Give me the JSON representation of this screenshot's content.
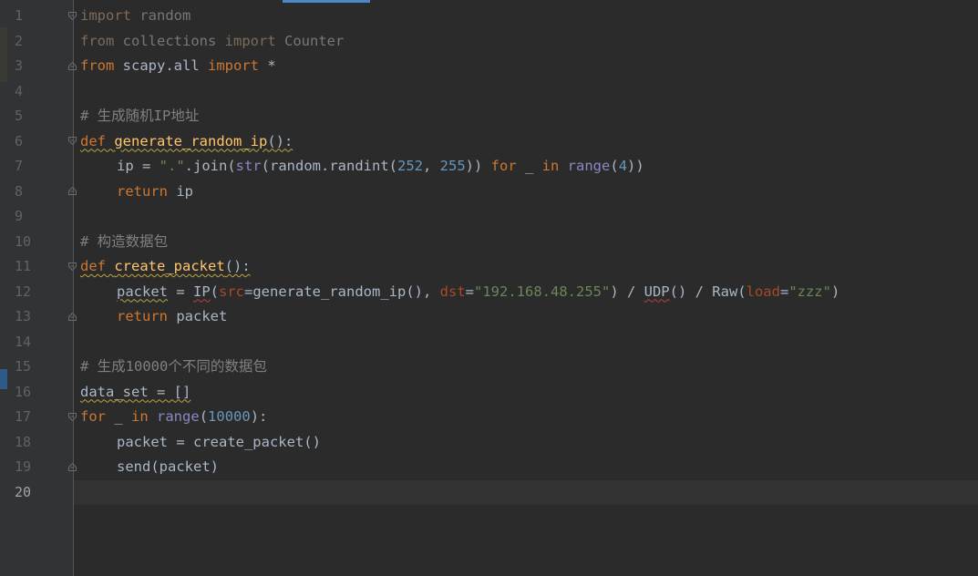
{
  "line_numbers": [
    "1",
    "2",
    "3",
    "4",
    "5",
    "6",
    "7",
    "8",
    "9",
    "10",
    "11",
    "12",
    "13",
    "14",
    "15",
    "16",
    "17",
    "18",
    "19",
    "20"
  ],
  "code": {
    "l1": {
      "kw": "import",
      "rest": " random"
    },
    "l2": {
      "kw1": "from",
      "mod": " collections ",
      "kw2": "import",
      "rest": " Counter"
    },
    "l3": {
      "kw1": "from",
      "mod": " scapy.all ",
      "kw2": "import",
      "rest": " *"
    },
    "l5": {
      "comment": "# 生成随机IP地址"
    },
    "l6": {
      "kw": "def",
      "fn": "generate_random_ip",
      "tail": "():"
    },
    "l7": {
      "a": "ip = ",
      "s1": "\".\"",
      "b": ".join(",
      "bi1": "str",
      "c": "(random.randint(",
      "n1": "252",
      "d": ", ",
      "n2": "255",
      "e": ")) ",
      "kw1": "for",
      "f": " _ ",
      "kw2": "in",
      "g": " ",
      "bi2": "range",
      "h": "(",
      "n3": "4",
      "i": "))"
    },
    "l8": {
      "kw": "return",
      "rest": " ip"
    },
    "l10": {
      "comment": "# 构造数据包"
    },
    "l11": {
      "kw": "def",
      "fn": "create_packet",
      "tail": "():"
    },
    "l12": {
      "var": "packet",
      "a": " = ",
      "ip": "IP",
      "b": "(",
      "p1": "src",
      "c": "=generate_random_ip(), ",
      "p2": "dst",
      "d": "=",
      "s1": "\"192.168.48.255\"",
      "e": ") / ",
      "udp": "UDP",
      "f": "() / Raw(",
      "p3": "load",
      "g": "=",
      "s2": "\"zzz\"",
      "h": ")"
    },
    "l13": {
      "kw": "return",
      "rest": " packet"
    },
    "l15": {
      "comment": "# 生成10000个不同的数据包"
    },
    "l16": {
      "var": "data_set",
      "rest": " = []"
    },
    "l17": {
      "kw1": "for",
      "a": " _ ",
      "kw2": "in",
      "b": " ",
      "bi": "range",
      "c": "(",
      "n": "10000",
      "d": "):"
    },
    "l18": {
      "text": "packet = create_packet()"
    },
    "l19": {
      "text": "send(packet)"
    }
  },
  "colors": {
    "background": "#2b2b2b",
    "gutter": "#313335",
    "keyword": "#cc7832",
    "function": "#ffc66d",
    "string": "#6a8759",
    "number": "#6897bb",
    "comment": "#808080",
    "builtin": "#8888c6",
    "parameter": "#aa4926"
  }
}
